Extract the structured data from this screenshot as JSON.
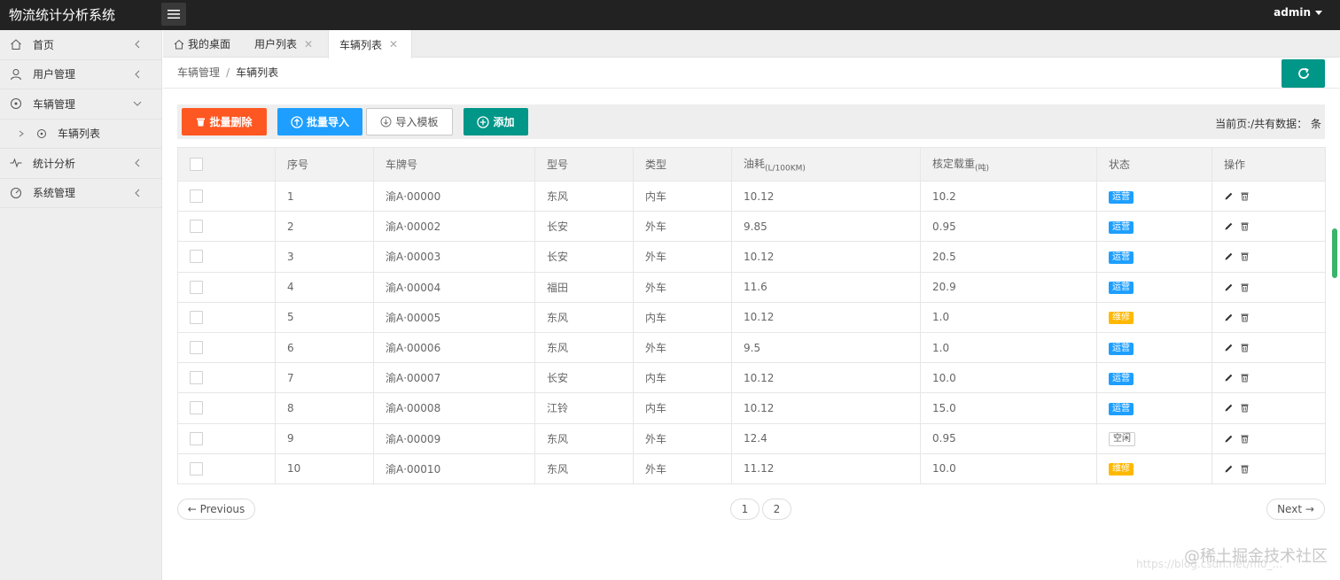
{
  "app": {
    "title": "物流统计分析系统",
    "user": "admin"
  },
  "sidebar": {
    "items": [
      {
        "label": "首页"
      },
      {
        "label": "用户管理"
      },
      {
        "label": "车辆管理"
      },
      {
        "label": "车辆列表"
      },
      {
        "label": "统计分析"
      },
      {
        "label": "系统管理"
      }
    ]
  },
  "tabs": [
    {
      "label": "我的桌面"
    },
    {
      "label": "用户列表"
    },
    {
      "label": "车辆列表"
    }
  ],
  "breadcrumb": {
    "parent": "车辆管理",
    "sep": "/",
    "current": "车辆列表"
  },
  "toolbar": {
    "batch_delete": "批量删除",
    "batch_import": "批量导入",
    "import_template": "导入模板",
    "add": "添加",
    "count_text": "当前页:/共有数据： 条"
  },
  "table": {
    "headers": {
      "index": "序号",
      "plate": "车牌号",
      "model": "型号",
      "type": "类型",
      "fuel": "油耗",
      "fuel_unit": "(L/100KM)",
      "load": "核定载重",
      "load_unit": "(吨)",
      "status": "状态",
      "ops": "操作"
    },
    "rows": [
      {
        "index": "1",
        "plate": "渝A·00000",
        "model": "东风",
        "type": "内车",
        "fuel": "10.12",
        "load": "10.2",
        "status": "运营"
      },
      {
        "index": "2",
        "plate": "渝A·00002",
        "model": "长安",
        "type": "外车",
        "fuel": "9.85",
        "load": "0.95",
        "status": "运营"
      },
      {
        "index": "3",
        "plate": "渝A·00003",
        "model": "长安",
        "type": "外车",
        "fuel": "10.12",
        "load": "20.5",
        "status": "运营"
      },
      {
        "index": "4",
        "plate": "渝A·00004",
        "model": "福田",
        "type": "外车",
        "fuel": "11.6",
        "load": "20.9",
        "status": "运营"
      },
      {
        "index": "5",
        "plate": "渝A·00005",
        "model": "东风",
        "type": "内车",
        "fuel": "10.12",
        "load": "1.0",
        "status": "维修"
      },
      {
        "index": "6",
        "plate": "渝A·00006",
        "model": "东风",
        "type": "外车",
        "fuel": "9.5",
        "load": "1.0",
        "status": "运营"
      },
      {
        "index": "7",
        "plate": "渝A·00007",
        "model": "长安",
        "type": "内车",
        "fuel": "10.12",
        "load": "10.0",
        "status": "运营"
      },
      {
        "index": "8",
        "plate": "渝A·00008",
        "model": "江铃",
        "type": "内车",
        "fuel": "10.12",
        "load": "15.0",
        "status": "运营"
      },
      {
        "index": "9",
        "plate": "渝A·00009",
        "model": "东风",
        "type": "外车",
        "fuel": "12.4",
        "load": "0.95",
        "status": "空闲"
      },
      {
        "index": "10",
        "plate": "渝A·00010",
        "model": "东风",
        "type": "外车",
        "fuel": "11.12",
        "load": "10.0",
        "status": "维修"
      }
    ]
  },
  "status_colors": {
    "运营": "#1E9FFF",
    "维修": "#FFB800",
    "空闲": "#ffffff"
  },
  "pagination": {
    "prev": "← Previous",
    "pages": [
      "1",
      "2"
    ],
    "next": "Next →"
  },
  "watermark": {
    "main": "@稀土掘金技术社区",
    "url": "https://blog.csdn.net/m0_..."
  }
}
